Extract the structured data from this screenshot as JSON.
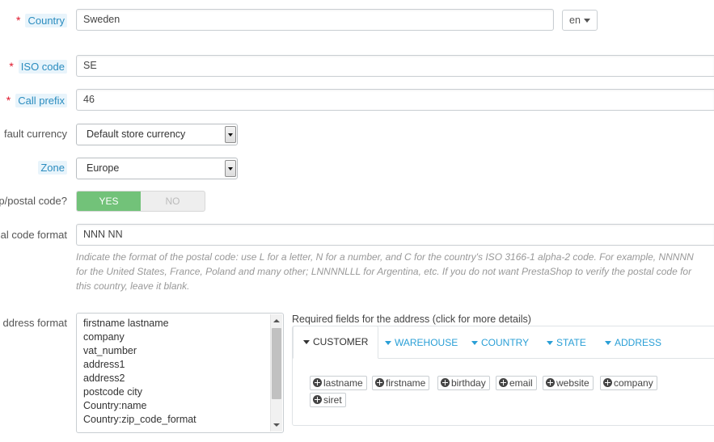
{
  "labels": {
    "country": "Country",
    "iso_code": "ISO code",
    "call_prefix": "Call prefix",
    "default_currency": "fault currency",
    "zone": "Zone",
    "need_zip": "p/postal code?",
    "zip_format": "al code format",
    "address_format": "ddress format"
  },
  "values": {
    "country": "Sweden",
    "language": "en",
    "iso_code": "SE",
    "call_prefix": "46",
    "default_currency": "Default store currency",
    "zone": "Europe",
    "toggle_yes": "YES",
    "toggle_no": "NO",
    "zip_format": "NNN NN"
  },
  "zip_help": "Indicate the format of the postal code: use L for a letter, N for a number, and C for the country's ISO 3166-1 alpha-2 code. For example, NNNNN for the United States, France, Poland and many other; LNNNNLLL for Argentina, etc. If you do not want PrestaShop to verify the postal code for this country, leave it blank.",
  "address_lines": [
    "firstname lastname",
    "company",
    "vat_number",
    "address1",
    "address2",
    "postcode city",
    "Country:name",
    "Country:zip_code_format"
  ],
  "required_fields_title": "Required fields for the address (click for more details)",
  "tabs": [
    "CUSTOMER",
    "WAREHOUSE",
    "COUNTRY",
    "STATE",
    "ADDRESS"
  ],
  "field_buttons": [
    "lastname",
    "firstname",
    "birthday",
    "email",
    "website",
    "company",
    "siret"
  ],
  "colors": {
    "required": "#e0162b",
    "tab_link": "#2a9fd6",
    "toggle_on": "#72c279"
  }
}
